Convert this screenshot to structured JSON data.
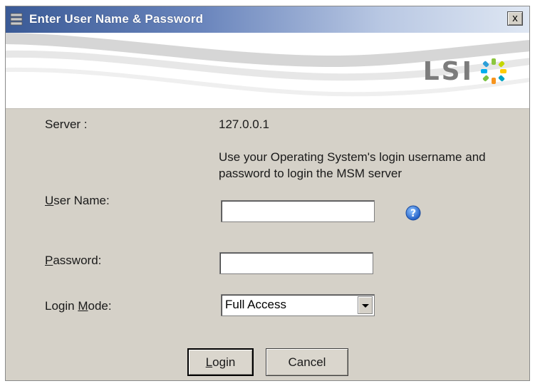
{
  "window": {
    "title": "Enter User Name & Password",
    "close_label": "x"
  },
  "logo": {
    "text": "LSI"
  },
  "server": {
    "label": "Server :",
    "value": "127.0.0.1"
  },
  "note": "Use your Operating System's login username and password to login the MSM server",
  "username": {
    "label_key": "U",
    "label_rest": "ser Name:",
    "value": ""
  },
  "password": {
    "label_key": "P",
    "label_rest": "assword:",
    "value": ""
  },
  "login_mode": {
    "label_pre": "Login ",
    "label_key": "M",
    "label_rest": "ode:",
    "selected": "Full Access"
  },
  "buttons": {
    "login_key": "L",
    "login_rest": "ogin",
    "cancel": "Cancel"
  },
  "colors": {
    "dialog_bg": "#d5d1c8",
    "title_gradient_start": "#3a5a96",
    "help_icon": "#2f6fd6"
  },
  "icons": {
    "title": "dialog-app-icon",
    "help": "help-question-icon",
    "dropdown": "chevron-down-icon"
  }
}
